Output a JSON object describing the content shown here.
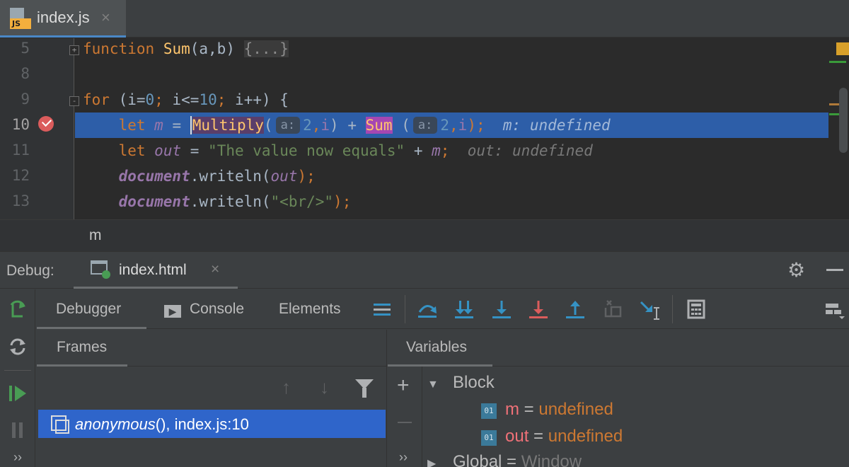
{
  "editor": {
    "tab": {
      "label": "index.js",
      "icon": "js-file-icon",
      "badge": "JS",
      "close": "×"
    },
    "lines": [
      {
        "number": "5"
      },
      {
        "number": "8"
      },
      {
        "number": "9"
      },
      {
        "number": "10"
      },
      {
        "number": "11"
      },
      {
        "number": "12"
      },
      {
        "number": "13"
      }
    ],
    "code": {
      "l5": {
        "kw": "function",
        "name": "Sum",
        "args": "(a,b)",
        "folded": "{...}"
      },
      "l9": {
        "kw": "for",
        "open": " (",
        "i1": "i",
        "eq": "=",
        "zero": "0",
        "sep1": "; ",
        "i2": "i",
        "le": "<=",
        "ten": "10",
        "sep2": "; ",
        "i3": "i",
        "inc": "++) {"
      },
      "l10": {
        "kw": "let",
        "var": "m",
        "eq": " = ",
        "fn1": "Multiply",
        "p1": "(",
        "hint1": "a:",
        "a1": "2",
        "c1": ",",
        "i1": "i",
        "close1": ")",
        "plus": " + ",
        "fn2": "Sum",
        "p2": " (",
        "hint2": "a:",
        "a2": "2",
        "c2": ",",
        "i2": "i",
        "close2": ");",
        "inline": "m: undefined"
      },
      "l11": {
        "kw": "let",
        "var": "out",
        "eq": " = ",
        "str": "\"The value now equals\"",
        "plus": " + ",
        "m": "m",
        "semi": ";",
        "inline": "out: undefined"
      },
      "l12": {
        "obj": "document",
        "call": ".writeln(",
        "arg": "out",
        "end": ");"
      },
      "l13": {
        "obj": "document",
        "call": ".writeln(",
        "str": "\"<br/>\"",
        "end": ");"
      }
    },
    "breadcrumb": "m"
  },
  "debug": {
    "title": "Debug:",
    "config_tab": {
      "label": "index.html",
      "close": "×"
    },
    "tabs": {
      "debugger": "Debugger",
      "console": "Console",
      "elements": "Elements"
    },
    "frames": {
      "title": "Frames",
      "items": [
        {
          "func": "anonymous",
          "rest": "(), index.js:10"
        }
      ]
    },
    "variables": {
      "title": "Variables",
      "block": {
        "label": "Block",
        "vars": [
          {
            "name": "m",
            "value": "undefined"
          },
          {
            "name": "out",
            "value": "undefined"
          }
        ]
      },
      "global": {
        "label": "Global",
        "value": "Window"
      },
      "eq": " = ",
      "var_icon": "01"
    },
    "more": "››"
  },
  "colors": {
    "accent": "#4a88c7",
    "execution_line": "#2d5ea8",
    "selected_frame": "#2f65ca",
    "keyword": "#cc7832",
    "function": "#ffc66d",
    "number": "#6897bb",
    "string": "#6a8759",
    "breakpoint": "#db5c5c"
  },
  "icons": {
    "step_over": "step-over-icon",
    "step_into": "step-into-icon",
    "force_step_into": "force-step-into-icon",
    "step_out": "step-out-icon",
    "run_to_cursor": "run-to-cursor-icon",
    "evaluate": "calculator-icon",
    "settings": "gear-icon"
  }
}
